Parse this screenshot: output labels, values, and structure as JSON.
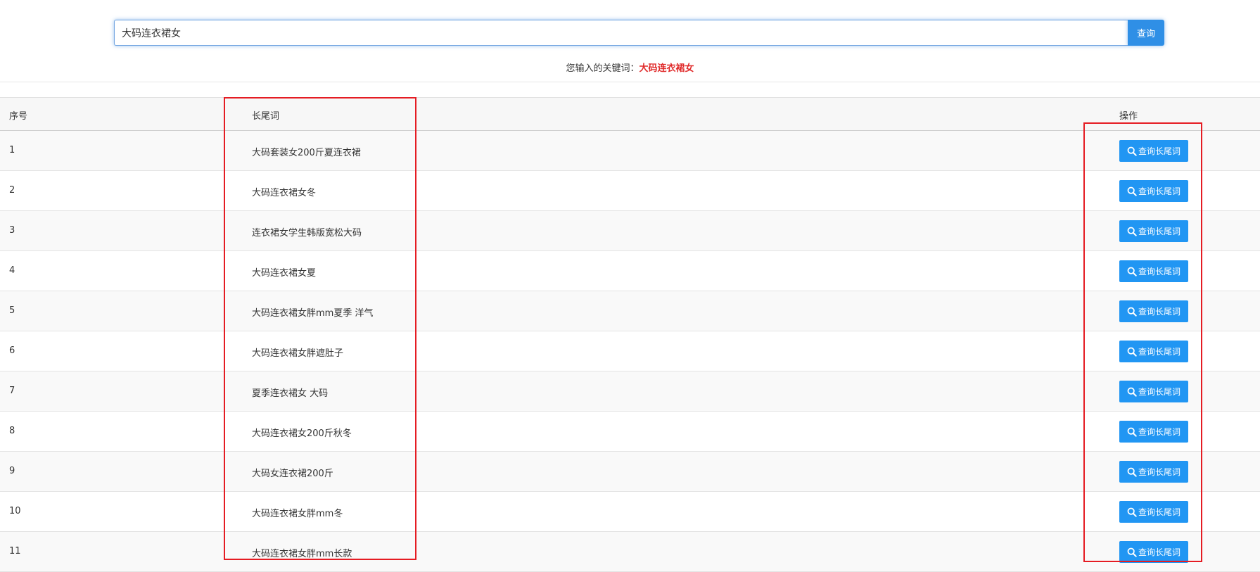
{
  "search": {
    "value": "大码连衣裙女",
    "button_label": "查询"
  },
  "keyword_line": {
    "prefix": "您输入的关键词：",
    "keyword": "大码连衣裙女"
  },
  "table": {
    "headers": {
      "index": "序号",
      "longtail": "长尾词",
      "operation": "操作"
    },
    "rows": [
      {
        "index": "1",
        "word": "大码套装女200斤夏连衣裙"
      },
      {
        "index": "2",
        "word": "大码连衣裙女冬"
      },
      {
        "index": "3",
        "word": "连衣裙女学生韩版宽松大码"
      },
      {
        "index": "4",
        "word": "大码连衣裙女夏"
      },
      {
        "index": "5",
        "word": "大码连衣裙女胖mm夏季 洋气"
      },
      {
        "index": "6",
        "word": "大码连衣裙女胖遮肚子"
      },
      {
        "index": "7",
        "word": "夏季连衣裙女 大码"
      },
      {
        "index": "8",
        "word": "大码连衣裙女200斤秋冬"
      },
      {
        "index": "9",
        "word": "大码女连衣裙200斤"
      },
      {
        "index": "10",
        "word": "大码连衣裙女胖mm冬"
      },
      {
        "index": "11",
        "word": "大码连衣裙女胖mm长款"
      }
    ],
    "row_button_label": "查询长尾词",
    "row_button_icon": "search-icon"
  },
  "colors": {
    "primary": "#2196f3",
    "keyword_red": "#e02a2a",
    "annotation_red": "#e51c23"
  }
}
